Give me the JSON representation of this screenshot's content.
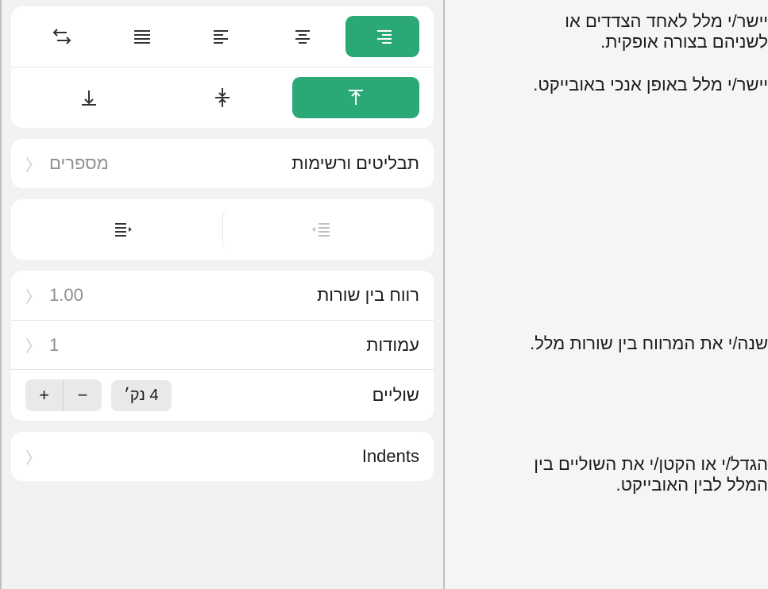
{
  "annotations": {
    "horizontal_align": "יישר/י מלל לאחד הצדדים או לשניהם בצורה אופקית.",
    "vertical_align": "יישר/י מלל באופן אנכי באובייקט.",
    "line_spacing": "שנה/י את המרווח בין שורות מלל.",
    "margins": "הגדל/י או הקטן/י את השוליים בין המלל לבין האובייקט."
  },
  "panel": {
    "bullets_lists": {
      "label": "תבליטים ורשימות",
      "value": "מספרים"
    },
    "line_spacing": {
      "label": "רווח בין שורות",
      "value": "1.00"
    },
    "columns": {
      "label": "עמודות",
      "value": "1"
    },
    "margins": {
      "label": "שוליים",
      "value": "4 נק׳"
    },
    "indents": {
      "label": "Indents"
    }
  }
}
